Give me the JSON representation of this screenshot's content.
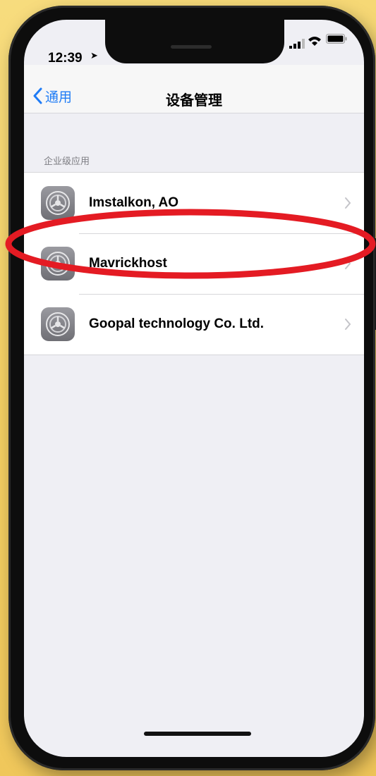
{
  "status_bar": {
    "time": "12:39"
  },
  "nav": {
    "back_label": "通用",
    "title": "设备管理"
  },
  "section": {
    "header": "企业级应用"
  },
  "apps": [
    {
      "name": "Imstalkon, AO"
    },
    {
      "name": "Mavrickhost"
    },
    {
      "name": "Goopal technology Co. Ltd."
    }
  ],
  "colors": {
    "accent": "#1f7cf6",
    "highlight": "#e41b23",
    "background": "#f3cf63"
  },
  "icons": {
    "back": "chevron-left-icon",
    "row_icon": "settings-gear-icon",
    "row_chevron": "chevron-right-icon",
    "location": "location-arrow-icon",
    "signal": "cellular-signal-icon",
    "wifi": "wifi-icon",
    "battery": "battery-icon"
  }
}
